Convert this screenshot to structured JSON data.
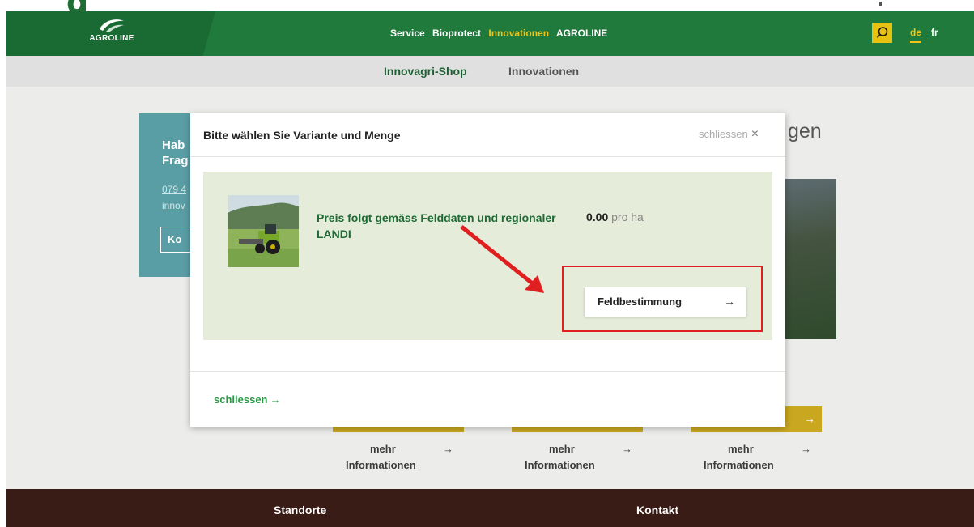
{
  "top_strip": {
    "partial_text": "g"
  },
  "header": {
    "logo_text": "AGROLINE",
    "nav": [
      {
        "label": "Service",
        "active": false
      },
      {
        "label": "Bioprotect",
        "active": false
      },
      {
        "label": "Innovationen",
        "active": true
      },
      {
        "label": "AGROLINE",
        "active": false
      }
    ],
    "lang_de": "de",
    "lang_fr": "fr",
    "search_icon": "search-icon"
  },
  "subnav": {
    "shop": "Innovagri-Shop",
    "innovations": "Innovationen"
  },
  "background": {
    "card_question": "Hab\nFrag",
    "card_tel": "079 4",
    "card_mail": "innov",
    "card_button": "Ko",
    "heading_fragment": "gen",
    "more_items": [
      {
        "line1": "mehr",
        "line2": "Informationen"
      },
      {
        "line1": "mehr",
        "line2": "Informationen"
      },
      {
        "line1": "mehr",
        "line2": "Informationen"
      }
    ],
    "arrow": "→"
  },
  "footer": {
    "left": "Standorte",
    "right": "Kontakt"
  },
  "modal": {
    "title": "Bitte wählen Sie Variante und Menge",
    "close_top": "schliessen",
    "close_icon": "×",
    "product_name": "Preis folgt gemäss Felddaten und regionaler LANDI",
    "price_value": "0.00",
    "price_unit": "pro ha",
    "action_label": "Feldbestimmung",
    "action_arrow": "→",
    "close_bottom": "schliessen",
    "close_bottom_arrow": "→"
  },
  "colors": {
    "brand_green": "#1f7a3b",
    "accent_yellow": "#f0c419",
    "product_bg": "#e5ecd9",
    "annotation_red": "#e02020"
  }
}
